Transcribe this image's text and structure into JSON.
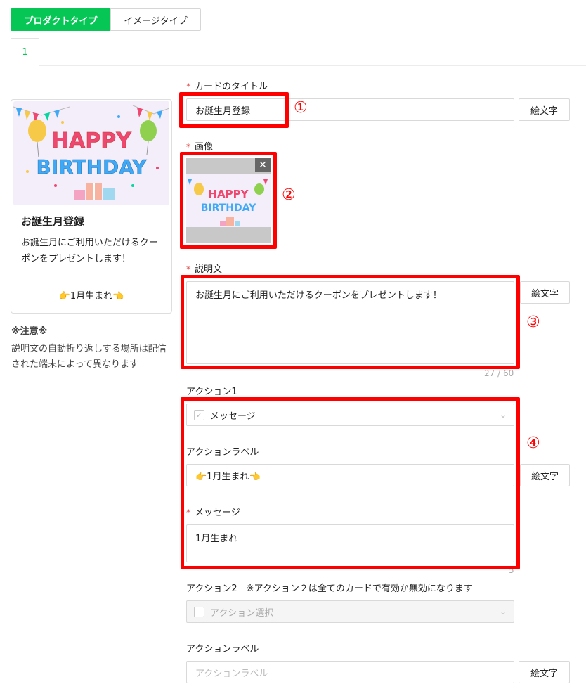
{
  "toggle": {
    "product_type": "プロダクトタイプ",
    "image_type": "イメージタイプ"
  },
  "tab": {
    "label": "1"
  },
  "preview": {
    "banner_line1": "HAPPY",
    "banner_line2": "BIRTHDAY",
    "title": "お誕生月登録",
    "description": "お誕生月にご利用いただけるクーポンをプレゼントします！",
    "action_label": "👉1月生まれ👈"
  },
  "note": {
    "title": "※注意※",
    "text": "説明文の自動折り返しする場所は配信された端末によって異なります"
  },
  "form": {
    "card_title": {
      "label": "カードのタイトル",
      "value": "お誕生月登録",
      "emoji_button": "絵文字",
      "marker": "①"
    },
    "image": {
      "label": "画像",
      "close": "✕",
      "marker": "②"
    },
    "description": {
      "label": "説明文",
      "value": "お誕生月にご利用いただけるクーポンをプレゼントします！",
      "emoji_button": "絵文字",
      "counter": "27 / 60",
      "marker": "③"
    },
    "action1": {
      "label": "アクション1",
      "type_value": "メッセージ",
      "action_label_title": "アクションラベル",
      "action_label_value": "👉1月生まれ👈",
      "emoji_button": "絵文字",
      "message_title": "メッセージ",
      "message_value": "1月生まれ",
      "counter": "5",
      "marker": "④"
    },
    "action2": {
      "label": "アクション2　※アクション２は全てのカードで有効か無効になります",
      "type_placeholder": "アクション選択",
      "action_label_title": "アクションラベル",
      "action_label_placeholder": "アクションラベル",
      "emoji_button": "絵文字"
    }
  },
  "colors": {
    "accent": "#06c755",
    "highlight": "#ff0000",
    "required": "#e23d3d"
  }
}
